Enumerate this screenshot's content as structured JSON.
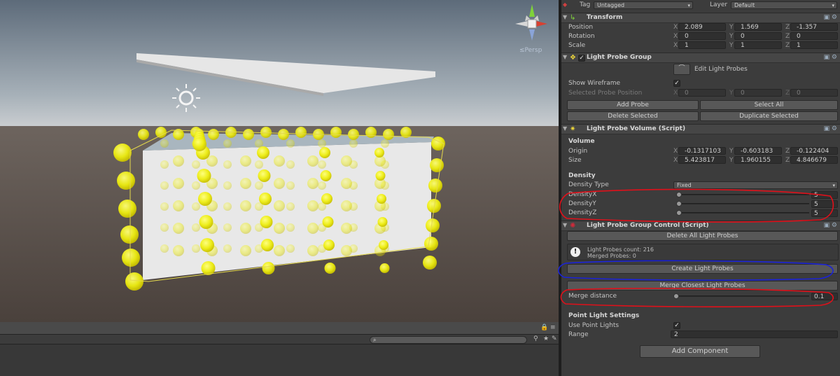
{
  "scene": {
    "persp_label": "≤Persp",
    "gizmo_axes": [
      "y",
      "x",
      "z"
    ]
  },
  "inspector": {
    "tag_label": "Tag",
    "tag_value": "Untagged",
    "layer_label": "Layer",
    "layer_value": "Default",
    "transform": {
      "title": "Transform",
      "position_label": "Position",
      "rotation_label": "Rotation",
      "scale_label": "Scale",
      "position": {
        "x": "2.089",
        "y": "1.569",
        "z": "-1.357"
      },
      "rotation": {
        "x": "0",
        "y": "0",
        "z": "0"
      },
      "scale": {
        "x": "1",
        "y": "1",
        "z": "1"
      }
    },
    "light_probe_group": {
      "title": "Light Probe Group",
      "edit_label": "Edit Light Probes",
      "show_wireframe_label": "Show Wireframe",
      "selected_probe_position_label": "Selected Probe Position",
      "selected": {
        "x": "0",
        "y": "0",
        "z": "0"
      },
      "add_probe": "Add Probe",
      "select_all": "Select All",
      "delete_selected": "Delete Selected",
      "duplicate_selected": "Duplicate Selected"
    },
    "light_probe_volume": {
      "title": "Light Probe Volume (Script)",
      "volume_label": "Volume",
      "origin_label": "Origin",
      "size_label": "Size",
      "origin": {
        "x": "-0.1317103",
        "y": "-0.603183",
        "z": "-0.122404"
      },
      "size": {
        "x": "5.423817",
        "y": "1.960155",
        "z": "4.846679"
      },
      "density_label": "Density",
      "density_type_label": "Density Type",
      "density_type_value": "Fixed",
      "density_x_label": "DensityX",
      "density_y_label": "DensityY",
      "density_z_label": "DensityZ",
      "density_x": "5",
      "density_y": "5",
      "density_z": "5"
    },
    "light_probe_group_control": {
      "title": "Light Probe Group Control (Script)",
      "delete_all": "Delete All Light Probes",
      "count_text": "Light Probes count: 216",
      "merged_text": "Merged Probes: 0",
      "create": "Create Light Probes",
      "merge_closest": "Merge Closest Light Probes",
      "merge_distance_label": "Merge distance",
      "merge_distance": "0.1"
    },
    "point_light": {
      "title": "Point Light Settings",
      "use_label": "Use Point Lights",
      "range_label": "Range",
      "range": "2"
    },
    "add_component": "Add Component"
  },
  "colors": {
    "probe_yellow": "#f2f21a",
    "annot_red": "#e0101a",
    "annot_blue": "#1a22d8"
  }
}
